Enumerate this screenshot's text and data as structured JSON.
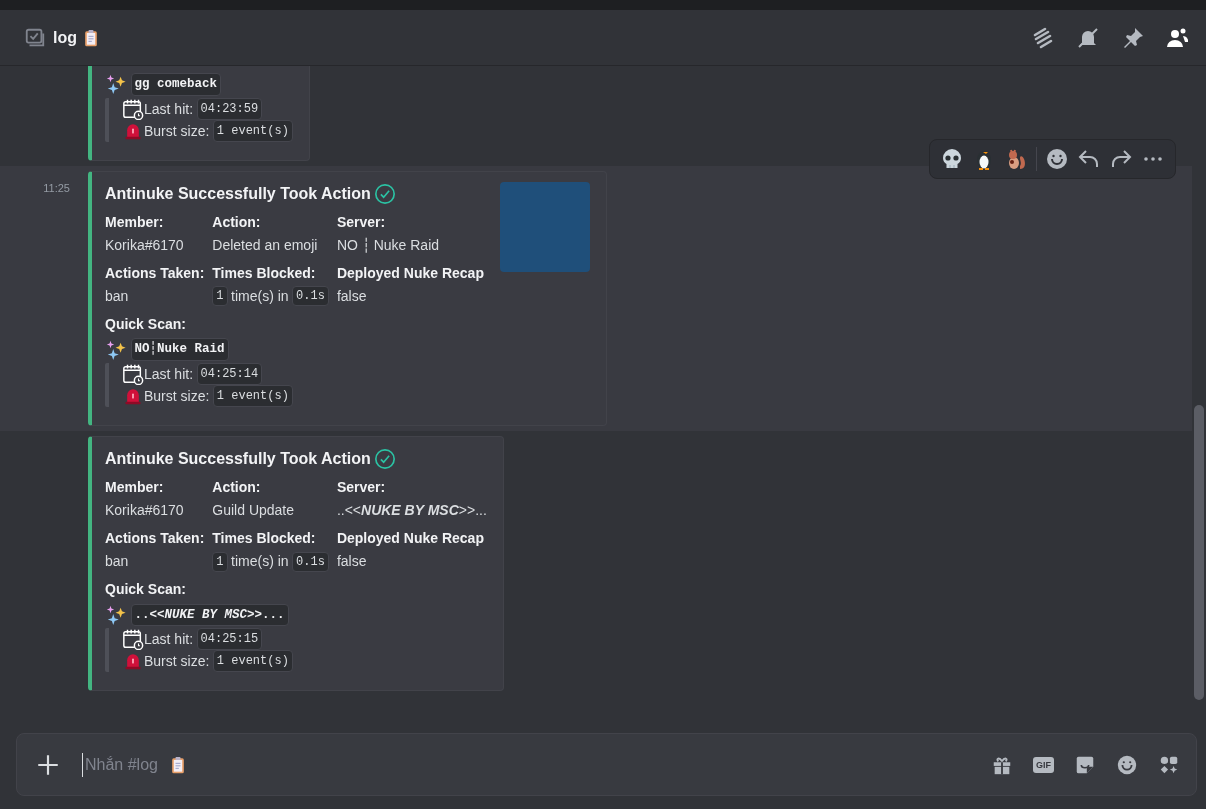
{
  "channel": {
    "name": "log",
    "placeholder": "Nhắn #log"
  },
  "messages": [
    {
      "hovered": false,
      "continued": true,
      "embed": {
        "thumbnail": false,
        "quick_scan": {
          "name": "gg comeback",
          "last_hit_label": "Last hit:",
          "last_hit": "04:23:59",
          "burst_label": "Burst size:",
          "burst": "1 event(s)"
        }
      }
    },
    {
      "timestamp": "11:25",
      "hovered": true,
      "continued": false,
      "embed": {
        "title": "Antinuke Successfully Took Action",
        "thumbnail": true,
        "fields": [
          {
            "name": "Member:",
            "parts": [
              {
                "text": "Korika#6170",
                "code": false
              }
            ]
          },
          {
            "name": "Action:",
            "parts": [
              {
                "text": "Deleted an emoji",
                "code": false
              }
            ]
          },
          {
            "name": "Server:",
            "parts": [
              {
                "text": "NO ┆ Nuke Raid",
                "code": false
              }
            ]
          },
          {
            "name": "Actions Taken:",
            "parts": [
              {
                "text": "ban",
                "code": false
              }
            ]
          },
          {
            "name": "Times Blocked:",
            "parts": [
              {
                "text": "1",
                "code": true
              },
              {
                "text": "time(s) in",
                "code": false
              },
              {
                "text": "0.1s",
                "code": true
              }
            ]
          },
          {
            "name": "Deployed Nuke Recap",
            "parts": [
              {
                "text": "false",
                "code": false
              }
            ]
          }
        ],
        "quick_scan_label": "Quick Scan:",
        "quick_scan": {
          "name": "NO┆Nuke Raid",
          "last_hit_label": "Last hit:",
          "last_hit": "04:25:14",
          "burst_label": "Burst size:",
          "burst": "1 event(s)"
        }
      }
    },
    {
      "hovered": false,
      "continued": false,
      "embed": {
        "title": "Antinuke Successfully Took Action",
        "thumbnail": false,
        "fields": [
          {
            "name": "Member:",
            "parts": [
              {
                "text": "Korika#6170",
                "code": false
              }
            ]
          },
          {
            "name": "Action:",
            "parts": [
              {
                "text": "Guild Update",
                "code": false
              }
            ]
          },
          {
            "name": "Server:",
            "parts": [
              {
                "text": "..<<*NUKE BY MSC*>>...",
                "code": false
              }
            ]
          },
          {
            "name": "Actions Taken:",
            "parts": [
              {
                "text": "ban",
                "code": false
              }
            ]
          },
          {
            "name": "Times Blocked:",
            "parts": [
              {
                "text": "1",
                "code": true
              },
              {
                "text": "time(s) in",
                "code": false
              },
              {
                "text": "0.1s",
                "code": true
              }
            ]
          },
          {
            "name": "Deployed Nuke Recap",
            "parts": [
              {
                "text": "false",
                "code": false
              }
            ]
          }
        ],
        "quick_scan_label": "Quick Scan:",
        "quick_scan": {
          "name": "..<<*NUKE BY MSC*>>...",
          "last_hit_label": "Last hit:",
          "last_hit": "04:25:15",
          "burst_label": "Burst size:",
          "burst": "1 event(s)"
        }
      }
    }
  ],
  "composer": {
    "gif_label": "GIF"
  }
}
